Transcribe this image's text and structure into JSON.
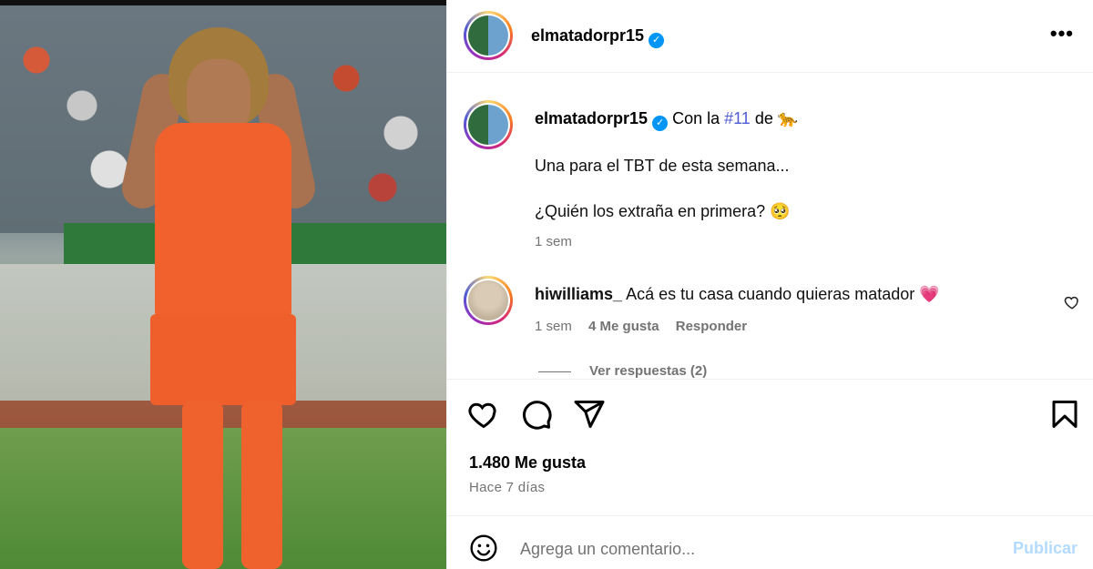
{
  "post": {
    "username": "elmatadorpr15",
    "verified_glyph": "✓",
    "more_glyph": "•••"
  },
  "caption": {
    "username": "elmatadorpr15",
    "prefix": "Con la",
    "hashtag": "#11",
    "middle": "de",
    "emoji_end": "🐆",
    "line2": "Una para el TBT de esta semana...",
    "line3": "¿Quién los extraña en primera? 🥺",
    "time": "1 sem"
  },
  "comment": {
    "username": "hiwilliams_",
    "text": "Acá es tu casa cuando quieras matador",
    "emoji": "💗",
    "time": "1 sem",
    "likes": "4 Me gusta",
    "reply_label": "Responder",
    "view_replies": "Ver respuestas (2)"
  },
  "actions": {
    "icons": [
      "heart-icon",
      "comment-icon",
      "share-icon",
      "bookmark-icon"
    ]
  },
  "stats": {
    "likes": "1.480 Me gusta",
    "date": "Hace 7 días"
  },
  "compose": {
    "placeholder": "Agrega un comentario...",
    "publish_label": "Publicar"
  },
  "colors": {
    "accent": "#0095f6",
    "hashtag": "#4f5bd5",
    "muted": "#737373",
    "publish_disabled": "#b3dbff",
    "comment_heart": "#ff3b6f"
  }
}
